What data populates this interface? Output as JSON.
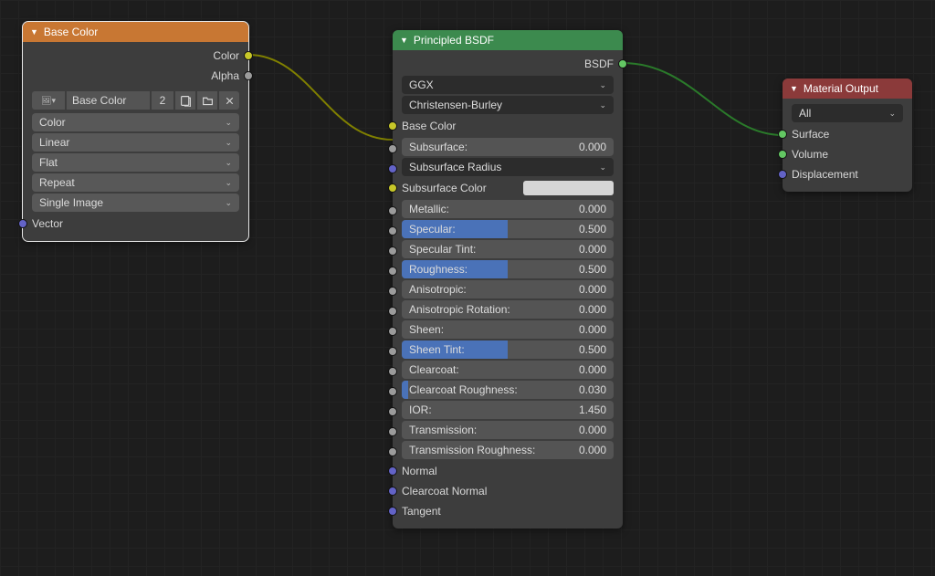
{
  "nodes": {
    "baseColor": {
      "title": "Base Color",
      "outputs": {
        "color": "Color",
        "alpha": "Alpha"
      },
      "imageName": "Base Color",
      "users": "2",
      "dropdowns": {
        "colorSpace": "Color",
        "interp": "Linear",
        "projection": "Flat",
        "extension": "Repeat",
        "source": "Single Image"
      },
      "vector": "Vector"
    },
    "bsdf": {
      "title": "Principled BSDF",
      "bsdfOut": "BSDF",
      "distribution": "GGX",
      "sss": "Christensen-Burley",
      "inputs": [
        {
          "label": "Base Color",
          "type": "link",
          "sock": "yellow"
        },
        {
          "label": "Subsurface:",
          "val": "0.000",
          "fill": 0,
          "sock": "grey"
        },
        {
          "label": "Subsurface Radius",
          "type": "dd",
          "sock": "purple"
        },
        {
          "label": "Subsurface Color",
          "type": "swatch",
          "sock": "yellow"
        },
        {
          "label": "Metallic:",
          "val": "0.000",
          "fill": 0,
          "sock": "grey"
        },
        {
          "label": "Specular:",
          "val": "0.500",
          "fill": 0.5,
          "sock": "grey"
        },
        {
          "label": "Specular Tint:",
          "val": "0.000",
          "fill": 0,
          "sock": "grey"
        },
        {
          "label": "Roughness:",
          "val": "0.500",
          "fill": 0.5,
          "sock": "grey"
        },
        {
          "label": "Anisotropic:",
          "val": "0.000",
          "fill": 0,
          "sock": "grey"
        },
        {
          "label": "Anisotropic Rotation:",
          "val": "0.000",
          "fill": 0,
          "sock": "grey"
        },
        {
          "label": "Sheen:",
          "val": "0.000",
          "fill": 0,
          "sock": "grey"
        },
        {
          "label": "Sheen Tint:",
          "val": "0.500",
          "fill": 0.5,
          "sock": "grey"
        },
        {
          "label": "Clearcoat:",
          "val": "0.000",
          "fill": 0,
          "sock": "grey"
        },
        {
          "label": "Clearcoat Roughness:",
          "val": "0.030",
          "fill": 0.03,
          "sock": "grey"
        },
        {
          "label": "IOR:",
          "val": "1.450",
          "fill": 0,
          "sock": "grey",
          "nofill": true
        },
        {
          "label": "Transmission:",
          "val": "0.000",
          "fill": 0,
          "sock": "grey"
        },
        {
          "label": "Transmission Roughness:",
          "val": "0.000",
          "fill": 0,
          "sock": "grey"
        },
        {
          "label": "Normal",
          "type": "link",
          "sock": "purple"
        },
        {
          "label": "Clearcoat Normal",
          "type": "link",
          "sock": "purple"
        },
        {
          "label": "Tangent",
          "type": "link",
          "sock": "purple"
        }
      ]
    },
    "output": {
      "title": "Material Output",
      "target": "All",
      "inputs": {
        "surface": {
          "label": "Surface",
          "sock": "green"
        },
        "volume": {
          "label": "Volume",
          "sock": "green"
        },
        "displacement": {
          "label": "Displacement",
          "sock": "purple"
        }
      }
    }
  }
}
